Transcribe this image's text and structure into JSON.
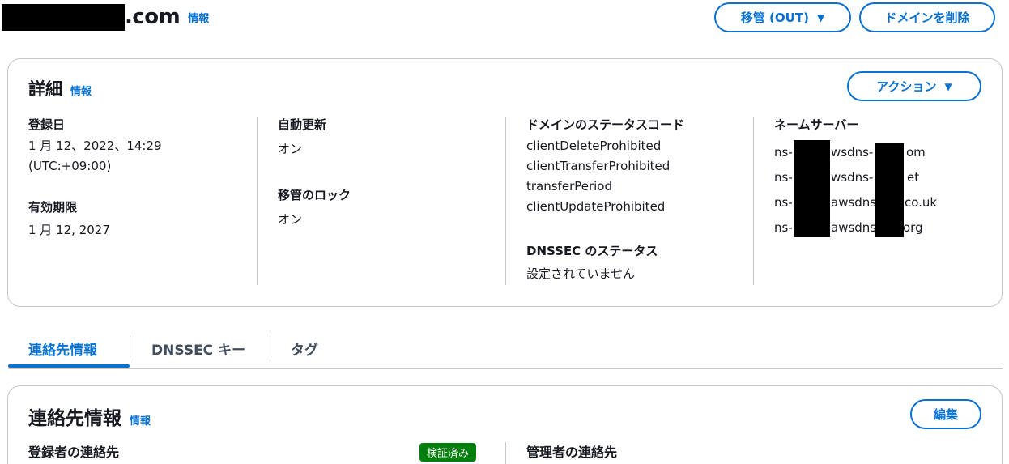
{
  "header": {
    "domain_suffix": ".com",
    "info_label": "情報",
    "transfer_out_label": "移管 (OUT)",
    "delete_domain_label": "ドメインを削除"
  },
  "details": {
    "title": "詳細",
    "info_label": "情報",
    "actions_label": "アクション",
    "registered_on_label": "登録日",
    "registered_on_value": "1 月 12、2022、14:29",
    "registered_on_tz": "(UTC:+09:00)",
    "expires_on_label": "有効期限",
    "expires_on_value": "1 月 12, 2027",
    "auto_renew_label": "自動更新",
    "auto_renew_value": "オン",
    "transfer_lock_label": "移管のロック",
    "transfer_lock_value": "オン",
    "status_codes_label": "ドメインのステータスコード",
    "status_codes": [
      "clientDeleteProhibited",
      "clientTransferProhibited",
      "transferPeriod",
      "clientUpdateProhibited"
    ],
    "dnssec_status_label": "DNSSEC のステータス",
    "dnssec_status_value": "設定されていません",
    "name_servers_label": "ネームサーバー",
    "name_servers": [
      {
        "a": "ns-",
        "b": "wsdns-",
        "c": "om"
      },
      {
        "a": "ns-",
        "b": "wsdns-",
        "c": "et"
      },
      {
        "a": "ns-",
        "b": "awsdns",
        "c": "co.uk"
      },
      {
        "a": "ns-",
        "b": "awsdns",
        "c": "org"
      }
    ]
  },
  "tabs": {
    "contacts": "連絡先情報",
    "dnssec_keys": "DNSSEC キー",
    "tags": "タグ"
  },
  "contacts": {
    "title": "連絡先情報",
    "info_label": "情報",
    "edit_label": "編集",
    "registrant_label": "登録者の連絡先",
    "verified_badge": "検証済み",
    "admin_label": "管理者の連絡先"
  },
  "colors": {
    "link": "#0972d3",
    "verified": "#037f0c",
    "border": "#c6c6cd"
  }
}
